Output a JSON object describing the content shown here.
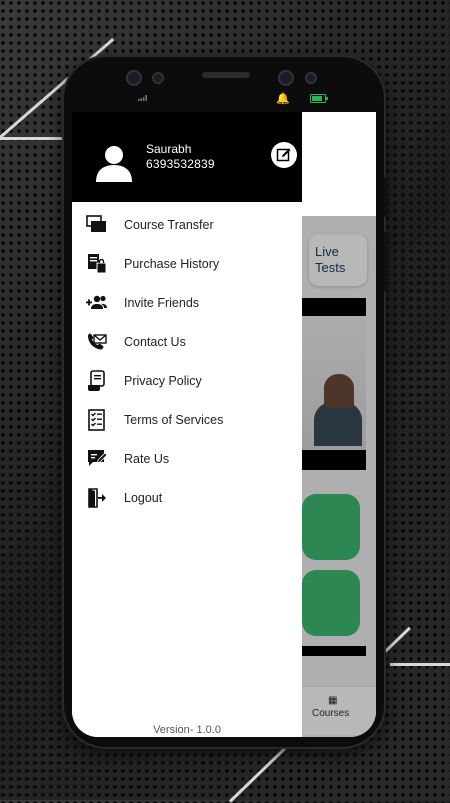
{
  "status_bar": {
    "battery_color": "#29b34a"
  },
  "user": {
    "name": "Saurabh",
    "phone": "6393532839",
    "avatar_icon": "person-icon",
    "edit_icon": "edit-icon"
  },
  "menu": [
    {
      "label": "Course Transfer",
      "icon": "stack-icon"
    },
    {
      "label": "Purchase History",
      "icon": "receipt-bag-icon"
    },
    {
      "label": "Invite Friends",
      "icon": "add-group-icon"
    },
    {
      "label": "Contact Us",
      "icon": "contact-phone-icon"
    },
    {
      "label": "Privacy Policy",
      "icon": "scroll-document-icon"
    },
    {
      "label": "Terms of Services",
      "icon": "checklist-icon"
    },
    {
      "label": "Rate Us",
      "icon": "rate-edit-icon"
    },
    {
      "label": "Logout",
      "icon": "logout-icon"
    }
  ],
  "version": "Version- 1.0.0",
  "background_app": {
    "card_label": "Live Tests",
    "nav_label": "Courses",
    "card_color": "#3dbb72"
  },
  "colors": {
    "header": "#000000",
    "accent_text": "#1f3a66"
  }
}
